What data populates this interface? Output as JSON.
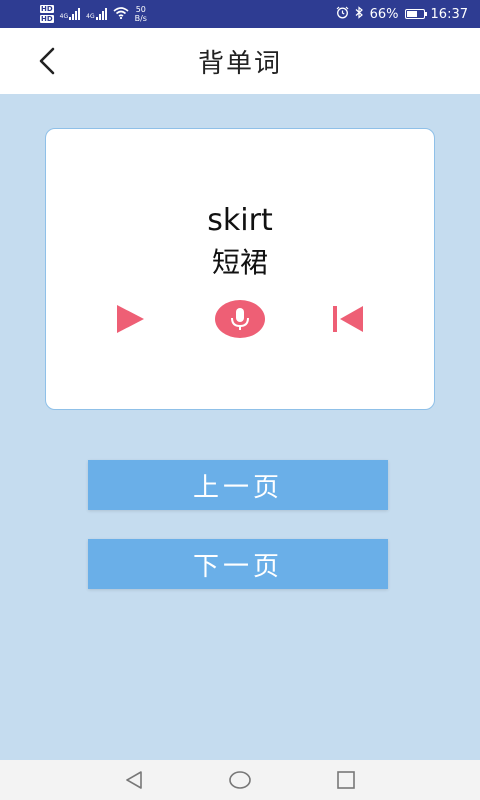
{
  "status_bar": {
    "sim1": "HD",
    "sim2": "HD",
    "net1": "4G",
    "net2": "4G",
    "speed_value": "50",
    "speed_unit": "B/s",
    "battery_percent": "66%",
    "time": "16:37",
    "battery_level": 0.66,
    "icons": [
      "alarm-icon",
      "bluetooth-icon",
      "battery-icon",
      "wifi-icon",
      "signal-icon"
    ]
  },
  "header": {
    "title": "背单词",
    "back_icon": "chevron-left-icon"
  },
  "card": {
    "word": "skirt",
    "meaning": "短裙",
    "controls": [
      "play-icon",
      "microphone-icon",
      "skip-previous-icon"
    ]
  },
  "buttons": {
    "prev_page": "上一页",
    "next_page": "下一页"
  },
  "colors": {
    "status_bar_bg": "#2e3c92",
    "page_bg": "#c5dcef",
    "card_border": "#8fc0e8",
    "button_bg": "#6aafe8",
    "icon_accent": "#ee5f75"
  },
  "system_nav": [
    "back-triangle-icon",
    "home-circle-icon",
    "recents-square-icon"
  ]
}
